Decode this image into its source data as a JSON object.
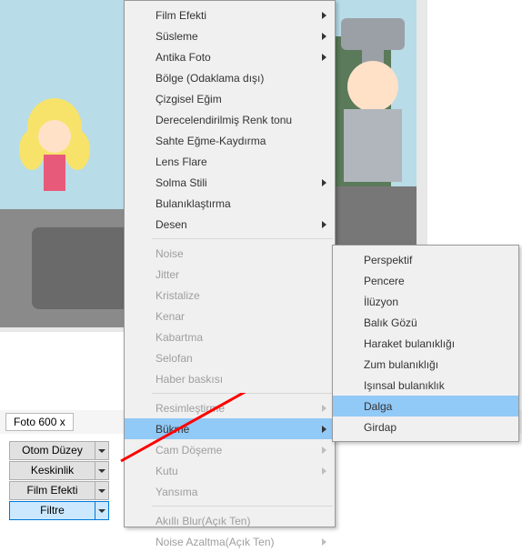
{
  "status": {
    "label": "Foto 600 x"
  },
  "buttons": [
    {
      "label": "Otom Düzey",
      "selected": false
    },
    {
      "label": "Keskinlik",
      "selected": false
    },
    {
      "label": "Film Efekti",
      "selected": false
    },
    {
      "label": "Filtre",
      "selected": true
    }
  ],
  "menu": [
    {
      "label": "Film Efekti",
      "sub": true
    },
    {
      "label": "Süsleme",
      "sub": true
    },
    {
      "label": "Antika Foto",
      "sub": true
    },
    {
      "label": "Bölge (Odaklama dışı)"
    },
    {
      "label": "Çizgisel Eğim"
    },
    {
      "label": "Derecelendirilmiş Renk tonu"
    },
    {
      "label": "Sahte Eğme-Kaydırma"
    },
    {
      "label": "Lens Flare"
    },
    {
      "label": "Solma Stili",
      "sub": true
    },
    {
      "label": "Bulanıklaştırma"
    },
    {
      "label": "Desen",
      "sub": true
    },
    {
      "sep": true
    },
    {
      "label": "Noise",
      "dis": true
    },
    {
      "label": "Jitter",
      "dis": true
    },
    {
      "label": "Kristalize",
      "dis": true
    },
    {
      "label": "Kenar",
      "dis": true
    },
    {
      "label": "Kabartma",
      "dis": true
    },
    {
      "label": "Selofan",
      "dis": true
    },
    {
      "label": "Haber baskısı",
      "dis": true
    },
    {
      "sep": true
    },
    {
      "label": "Resimleştirme",
      "dis": true,
      "sub": true
    },
    {
      "label": "Bükme",
      "sub": true,
      "hl": true
    },
    {
      "label": "Cam Döşeme",
      "dis": true,
      "sub": true
    },
    {
      "label": "Kutu",
      "dis": true,
      "sub": true
    },
    {
      "label": "Yansıma",
      "dis": true
    },
    {
      "sep": true
    },
    {
      "label": "Akıllı Blur(Açık Ten)",
      "dis": true
    },
    {
      "label": "Noise Azaltma(Açık Ten)",
      "dis": true,
      "sub": true
    }
  ],
  "submenu": [
    {
      "label": "Perspektif"
    },
    {
      "label": "Pencere"
    },
    {
      "label": "İlüzyon"
    },
    {
      "label": "Balık Gözü"
    },
    {
      "label": "Haraket bulanıklığı"
    },
    {
      "label": "Zum bulanıklığı"
    },
    {
      "label": "Işınsal bulanıklık"
    },
    {
      "label": "Dalga",
      "hl": true
    },
    {
      "label": "Girdap"
    }
  ],
  "colors": {
    "highlight": "#91c9f7",
    "menuBg": "#f0f0f0",
    "arrow": "#ff0000"
  }
}
